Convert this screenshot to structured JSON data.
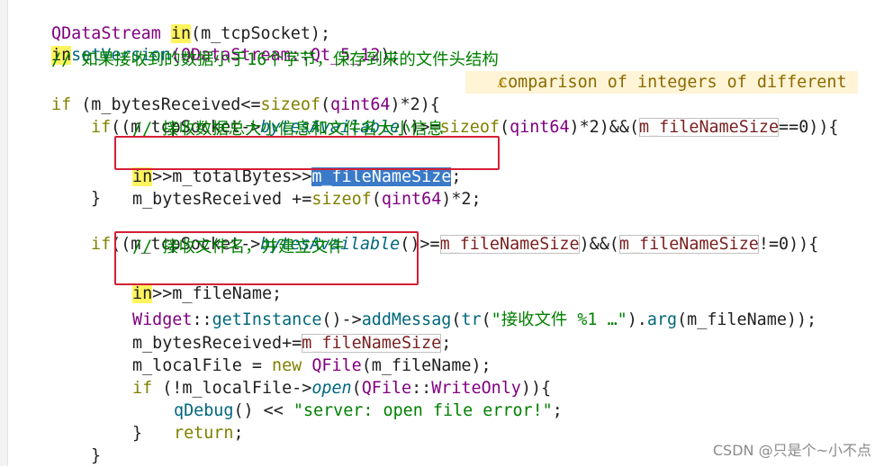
{
  "code": {
    "l1": {
      "a": "QDataStream ",
      "b": "in",
      "c": "(m_tcpSocket);"
    },
    "l2": {
      "a": "in",
      ".": ".",
      "b": "setVersion",
      "c": "(QDataStream::",
      "d": "Qt_5_12",
      ")": ");"
    },
    "l3": {
      "comment": "// 如果接收到的数据小于16个字节，保存到来的文件头结构"
    },
    "l4": {
      "kw": "if",
      "a": " (m_bytesReceived<=",
      "b": "sizeof",
      "c": "(",
      "d": "qint64",
      ")": ")*2){"
    },
    "warning": {
      "icon": "warning-triangle",
      "text": "comparison of integers of different"
    },
    "l5": {
      "kw": "if",
      "a": "((m_tcpSocket->",
      "b": "bytesAvailable",
      "c": "()>=",
      "d": "sizeof",
      "e": "(",
      "f": "qint64",
      "g": ")*2)&&(",
      "h": "m_fileNameSize",
      "i": "==0)){"
    },
    "l6": {
      "comment": "// 接收数据总大小信息和文件名大小信息"
    },
    "l7": {
      "a": "in",
      "b": ">>m_totalBytes>>",
      "c": "m_fileNameSize",
      "d": ";"
    },
    "l8": {
      "a": "m_bytesReceived +=",
      "b": "sizeof",
      "c": "(",
      "d": "qint64",
      "e": ")*2;"
    },
    "l9": {
      "a": "}"
    },
    "l10": {
      "kw": "if",
      "a": "((m_tcpSocket->",
      "b": "bytesAvailable",
      "c": "()>=",
      "d": "m_fileNameSize",
      "e": ")&&(",
      "f": "m_fileNameSize",
      "g": "!=0)){"
    },
    "l11": {
      "comment": "// 接收文件名，并建立文件"
    },
    "l12": {
      "a": "in",
      "b": ">>m_fileName;"
    },
    "l13": {
      "a": "Widget",
      "b": "::",
      "c": "getInstance",
      "d": "()->",
      "e": "addMessag",
      "f": "(",
      "g": "tr",
      "h": "(",
      "i": "\"接收文件 %1 …\"",
      "j": ").",
      "k": "arg",
      "l": "(m_fileName));"
    },
    "l14": {
      "a": "m_bytesReceived+=",
      "b": "m_fileNameSize",
      "c": ";"
    },
    "l15": {
      "a": "m_localFile = ",
      "b": "new ",
      "c": "QFile",
      "d": "(m_fileName);"
    },
    "l16": {
      "kw": "if",
      "a": " (!m_localFile->",
      "b": "open",
      "c": "(",
      "d": "QFile",
      "e": "::",
      "f": "WriteOnly",
      "g": ")){"
    },
    "l17": {
      "a": "qDebug",
      "b": "() << ",
      "c": "\"server: open file error!\"",
      "d": ";"
    },
    "l18": {
      "kw": "return",
      "a": ";"
    },
    "l19": {
      "a": "}"
    },
    "l20": {
      "a": "}"
    }
  },
  "watermark": "CSDN @只是个~小不点"
}
